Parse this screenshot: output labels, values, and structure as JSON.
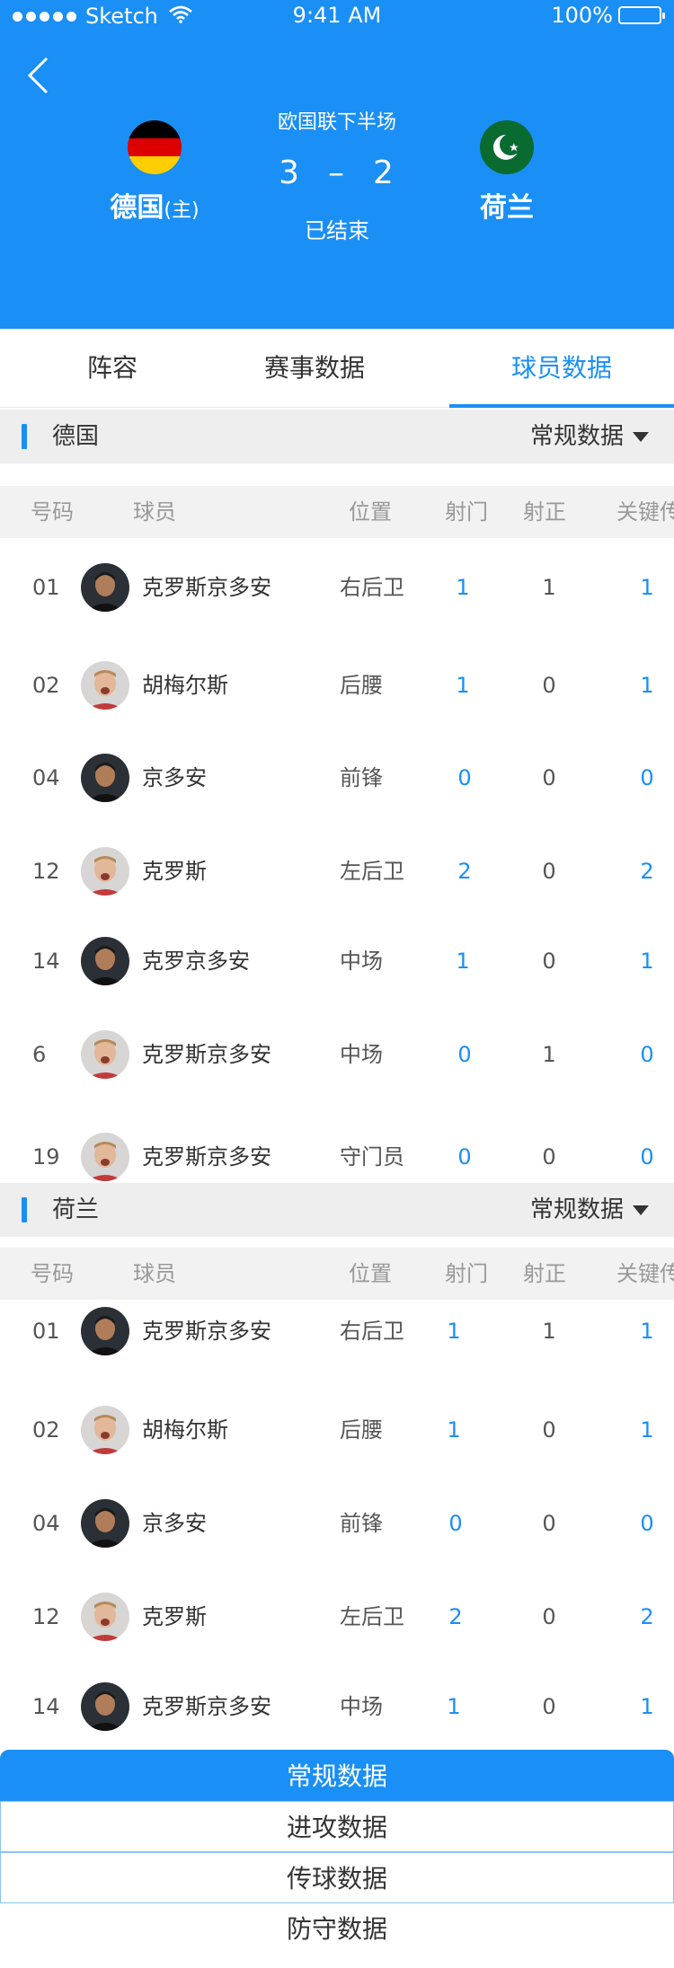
{
  "status_bar": {
    "carrier": "Sketch",
    "time": "9:41 AM",
    "battery": "100%"
  },
  "match": {
    "league": "欧国联下半场",
    "home": {
      "name": "德国",
      "tag": "(主)",
      "score": "3"
    },
    "away": {
      "name": "荷兰",
      "score": "2"
    },
    "dash": "–",
    "state": "已结束"
  },
  "tabs": [
    "阵容",
    "赛事数据",
    "球员数据"
  ],
  "columns": [
    "号码",
    "球员",
    "位置",
    "射门",
    "射正",
    "关键传"
  ],
  "sections": [
    {
      "team": "德国",
      "mode": "常规数据",
      "rows": [
        {
          "num": "01",
          "name": "克罗斯京多安",
          "pos": "右后卫",
          "shots": "1",
          "on_target": "1",
          "key": "1",
          "avatar": "avatar-dark"
        },
        {
          "num": "02",
          "name": "胡梅尔斯",
          "pos": "后腰",
          "shots": "1",
          "on_target": "0",
          "key": "1",
          "avatar": "avatar-light"
        },
        {
          "num": "04",
          "name": "京多安",
          "pos": "前锋",
          "shots": "0",
          "on_target": "0",
          "key": "0",
          "avatar": "avatar-dark"
        },
        {
          "num": "12",
          "name": "克罗斯",
          "pos": "左后卫",
          "shots": "2",
          "on_target": "0",
          "key": "2",
          "avatar": "avatar-light"
        },
        {
          "num": "14",
          "name": "克罗京多安",
          "pos": "中场",
          "shots": "1",
          "on_target": "0",
          "key": "1",
          "avatar": "avatar-dark"
        },
        {
          "num": "6",
          "name": "克罗斯京多安",
          "pos": "中场",
          "shots": "0",
          "on_target": "1",
          "key": "0",
          "avatar": "avatar-light"
        },
        {
          "num": "19",
          "name": "克罗斯京多安",
          "pos": "守门员",
          "shots": "0",
          "on_target": "0",
          "key": "0",
          "avatar": "avatar-light"
        }
      ]
    },
    {
      "team": "荷兰",
      "mode": "常规数据",
      "rows": [
        {
          "num": "01",
          "name": "克罗斯京多安",
          "pos": "右后卫",
          "shots": "1",
          "on_target": "1",
          "key": "1",
          "avatar": "avatar-dark"
        },
        {
          "num": "02",
          "name": "胡梅尔斯",
          "pos": "后腰",
          "shots": "1",
          "on_target": "0",
          "key": "1",
          "avatar": "avatar-light"
        },
        {
          "num": "04",
          "name": "京多安",
          "pos": "前锋",
          "shots": "0",
          "on_target": "0",
          "key": "0",
          "avatar": "avatar-dark"
        },
        {
          "num": "12",
          "name": "克罗斯",
          "pos": "左后卫",
          "shots": "2",
          "on_target": "0",
          "key": "2",
          "avatar": "avatar-light"
        },
        {
          "num": "14",
          "name": "克罗斯京多安",
          "pos": "中场",
          "shots": "1",
          "on_target": "0",
          "key": "1",
          "avatar": "avatar-dark"
        }
      ]
    }
  ],
  "mode_options": [
    "常规数据",
    "进攻数据",
    "传球数据",
    "防守数据"
  ],
  "colors": {
    "accent": "#1a8ff5",
    "section_bg": "#eeeeee",
    "header_bg": "#f2f2f2"
  },
  "icons": {
    "back": "chevron-left-icon",
    "dropdown": "triangle-down-icon",
    "home_flag": "germany-flag-icon",
    "away_flag": "crescent-flag-icon"
  }
}
